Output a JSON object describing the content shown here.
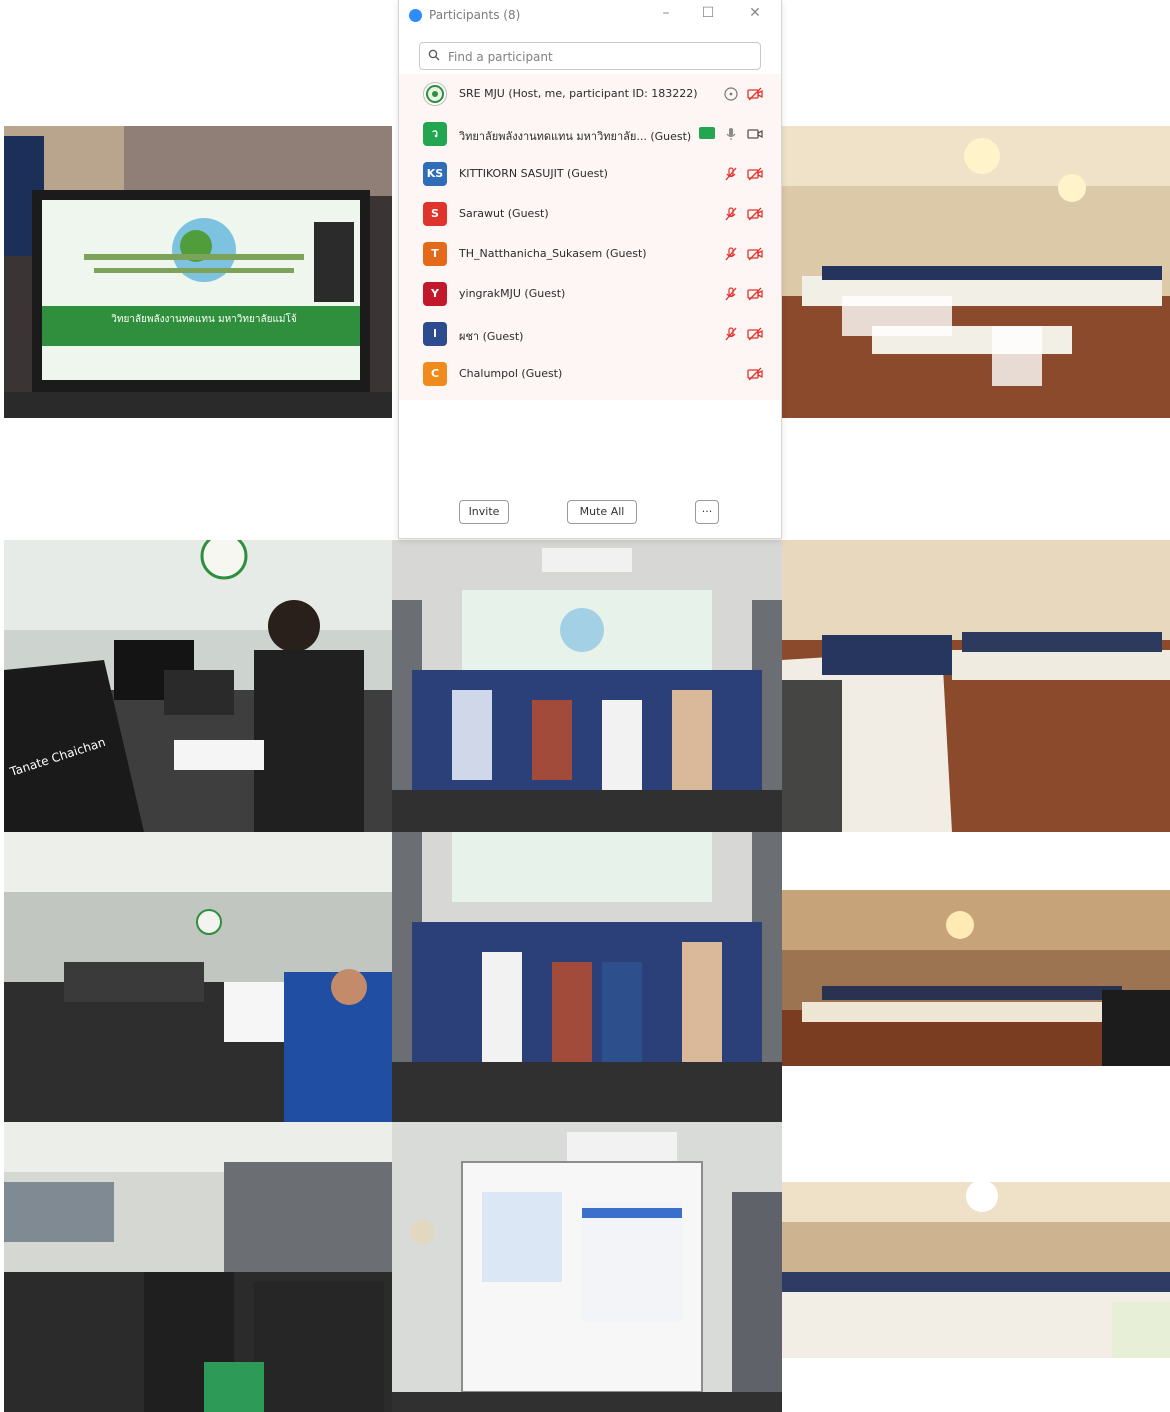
{
  "window": {
    "title": "Participants (8)",
    "controls": {
      "minimize": "–",
      "maximize": "☐",
      "close": "✕"
    }
  },
  "search": {
    "placeholder": "Find a participant"
  },
  "participants": [
    {
      "initials": "",
      "name": "SRE MJU (Host, me, participant ID: 183222)",
      "avatar_color": "#ffffff",
      "icons": [
        "more-icon",
        "video-off-icon"
      ]
    },
    {
      "initials": "ว",
      "name": "วิทยาลัยพลังงานทดแทน มหาวิทยาลัย... (Guest)",
      "avatar_color": "#22a64f",
      "icons": [
        "video-on-badge",
        "mic-on-icon",
        "video-icon"
      ]
    },
    {
      "initials": "KS",
      "name": "KITTIKORN SASUJIT (Guest)",
      "avatar_color": "#2f6db8",
      "icons": [
        "mic-muted-icon",
        "video-off-icon"
      ]
    },
    {
      "initials": "S",
      "name": "Sarawut (Guest)",
      "avatar_color": "#e0332b",
      "icons": [
        "mic-muted-icon",
        "video-off-icon"
      ]
    },
    {
      "initials": "T",
      "name": "TH_Natthanicha_Sukasem (Guest)",
      "avatar_color": "#e36a1a",
      "icons": [
        "mic-muted-icon",
        "video-off-icon"
      ]
    },
    {
      "initials": "Y",
      "name": "yingrakMJU (Guest)",
      "avatar_color": "#c2182b",
      "icons": [
        "mic-muted-icon",
        "video-off-icon"
      ]
    },
    {
      "initials": "l",
      "name": "ผชา (Guest)",
      "avatar_color": "#2c4c8f",
      "icons": [
        "mic-muted-icon",
        "video-off-icon"
      ]
    },
    {
      "initials": "C",
      "name": "Chalumpol (Guest)",
      "avatar_color": "#f08a1c",
      "icons": [
        "video-off-icon"
      ]
    }
  ],
  "footer": {
    "invite": "Invite",
    "mute_all": "Mute All",
    "more": "···"
  },
  "photos": {
    "screen_title": "วิทยาลัยพลังงานทดแทน มหาวิทยาลัยแม่โจ้",
    "monitor_name": "Tanate Chaichan"
  },
  "colors": {
    "accent": "#2d8cff",
    "muted_red": "#e0332b",
    "list_bg": "#fdf6f5",
    "carpet": "#8b4a2b",
    "wall_beige": "#d9c6a4"
  }
}
